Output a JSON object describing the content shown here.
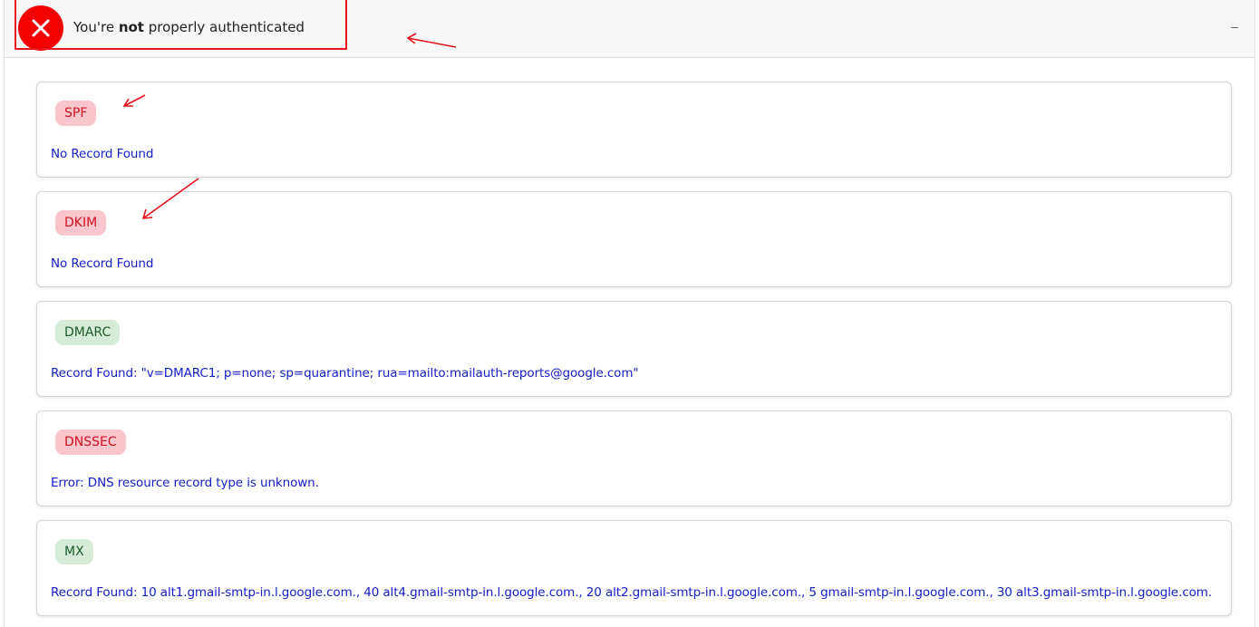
{
  "header": {
    "title_prefix": "You're ",
    "title_emphasis": "not",
    "title_suffix": " properly authenticated",
    "status_icon": "close-x-icon",
    "status_color": "#f30000",
    "collapse_symbol": "–"
  },
  "records": [
    {
      "label": "SPF",
      "status": "fail",
      "detail": "No Record Found"
    },
    {
      "label": "DKIM",
      "status": "fail",
      "detail": "No Record Found"
    },
    {
      "label": "DMARC",
      "status": "pass",
      "detail": "Record Found: \"v=DMARC1; p=none; sp=quarantine; rua=mailto:mailauth-reports@google.com\""
    },
    {
      "label": "DNSSEC",
      "status": "fail",
      "detail": "Error: DNS resource record type is unknown."
    },
    {
      "label": "MX",
      "status": "pass",
      "detail": "Record Found: 10 alt1.gmail-smtp-in.l.google.com., 40 alt4.gmail-smtp-in.l.google.com., 20 alt2.gmail-smtp-in.l.google.com., 5 gmail-smtp-in.l.google.com., 30 alt3.gmail-smtp-in.l.google.com."
    }
  ],
  "colors": {
    "fail_badge_bg": "#f8c6cc",
    "fail_badge_text": "#d4101e",
    "pass_badge_bg": "#d5ecd8",
    "pass_badge_text": "#1b5e28",
    "detail_text": "#1520c7",
    "annotation": "#e8121e"
  }
}
